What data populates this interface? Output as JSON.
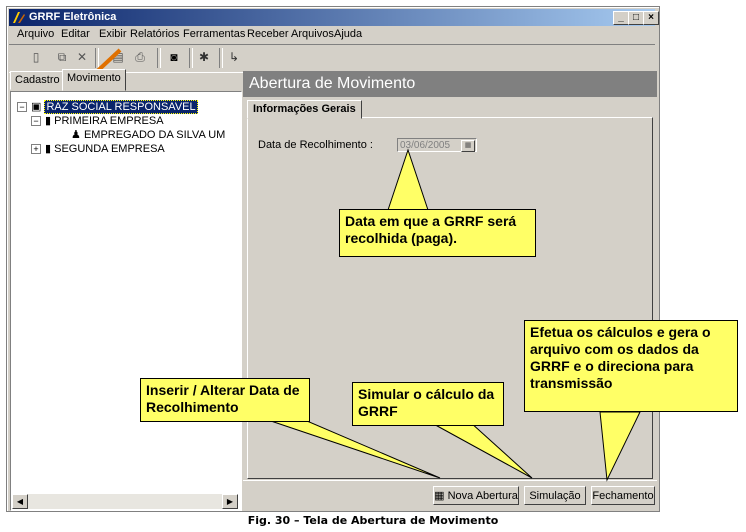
{
  "window": {
    "title": "GRRF Eletrônica"
  },
  "titlebar_buttons": {
    "minimize": "_",
    "maximize": "□",
    "close": "×"
  },
  "menu": {
    "items": [
      "Arquivo",
      "Editar",
      "Exibir",
      "Relatórios",
      "Ferramentas",
      "Receber Arquivos",
      "Ajuda"
    ]
  },
  "toolbar": {
    "icons": [
      "new-icon",
      "copy-icon",
      "delete-icon",
      "print-preview-icon",
      "print-icon",
      "binoculars-icon",
      "tools-icon",
      "exit-icon"
    ]
  },
  "left_tabs": [
    "Cadastro",
    "Movimento"
  ],
  "tree": {
    "root": "RAZ SOCIAL RESPONSAVEL",
    "company1": "PRIMEIRA EMPRESA",
    "employee1": "EMPREGADO DA SILVA UM",
    "company2": "SEGUNDA EMPRESA"
  },
  "panel": {
    "header": "Abertura de Movimento",
    "tab": "Informações Gerais",
    "date_label": "Data de Recolhimento :",
    "date_value": "03/06/2005"
  },
  "buttons": {
    "nova_abertura": "Nova Abertura",
    "simulacao": "Simulação",
    "fechamento": "Fechamento"
  },
  "callouts": {
    "date": "Data em que a GRRF será recolhida (paga).",
    "insert": "Inserir / Alterar Data de Recolhimento",
    "simulate": "Simular o cálculo da GRRF",
    "close": "Efetua os cálculos e gera o arquivo com os dados da GRRF e o direciona para transmissão"
  },
  "caption": "Fig. 30 – Tela de Abertura de Movimento",
  "colors": {
    "titlebar": "#0a246a",
    "callout": "#ffff66",
    "arrow": "#e07000",
    "window": "#d4d0c8"
  }
}
